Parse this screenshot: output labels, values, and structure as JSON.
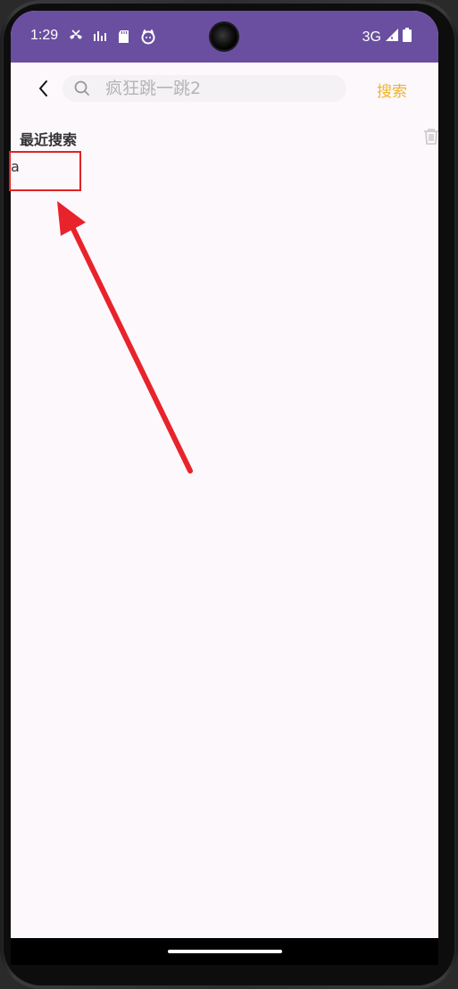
{
  "status_bar": {
    "time": "1:29",
    "network": "3G",
    "background_color": "#6a4fa0",
    "left_icons": [
      "missed-call-icon",
      "signal-strength-icon",
      "sd-card-icon",
      "cat-face-icon"
    ],
    "right_icons": [
      "cell-signal-icon",
      "battery-icon"
    ]
  },
  "search": {
    "placeholder": "疯狂跳一跳2",
    "value": "",
    "action_label": "搜索",
    "action_color": "#f0b429"
  },
  "recent": {
    "title": "最近搜索",
    "items": [
      "a"
    ]
  },
  "colors": {
    "page_background": "#fdf8fc",
    "annotation": "#e02424"
  }
}
